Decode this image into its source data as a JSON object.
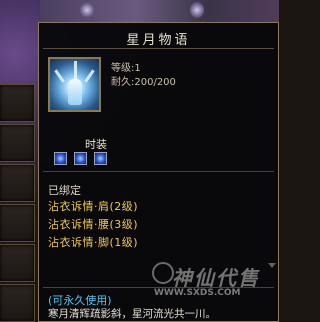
{
  "item": {
    "name": "星月物语",
    "level": "等级:1",
    "durability": "耐久:200/200",
    "icon": "ice-costume-icon"
  },
  "set_section": {
    "title": "时装",
    "gems": [
      "blue-gem-icon",
      "blue-gem-icon",
      "blue-gem-icon"
    ]
  },
  "binding": {
    "status": "已绑定",
    "lines": [
      "沾衣诉情·肩(2级)",
      "沾衣诉情·腰(3级)",
      "沾衣诉情·脚(1级)"
    ]
  },
  "footer": {
    "usage": "(可永久使用)",
    "flavor": "寒月清辉疏影斜，星河流光共一川。"
  },
  "watermark": {
    "text": "神仙代售",
    "url": "WWW.SXDS.COM"
  },
  "colors": {
    "title": "#e8e2d2",
    "set_line": "#f2c84a",
    "usage": "#4ec8f0",
    "border": "#8a7a5a"
  }
}
